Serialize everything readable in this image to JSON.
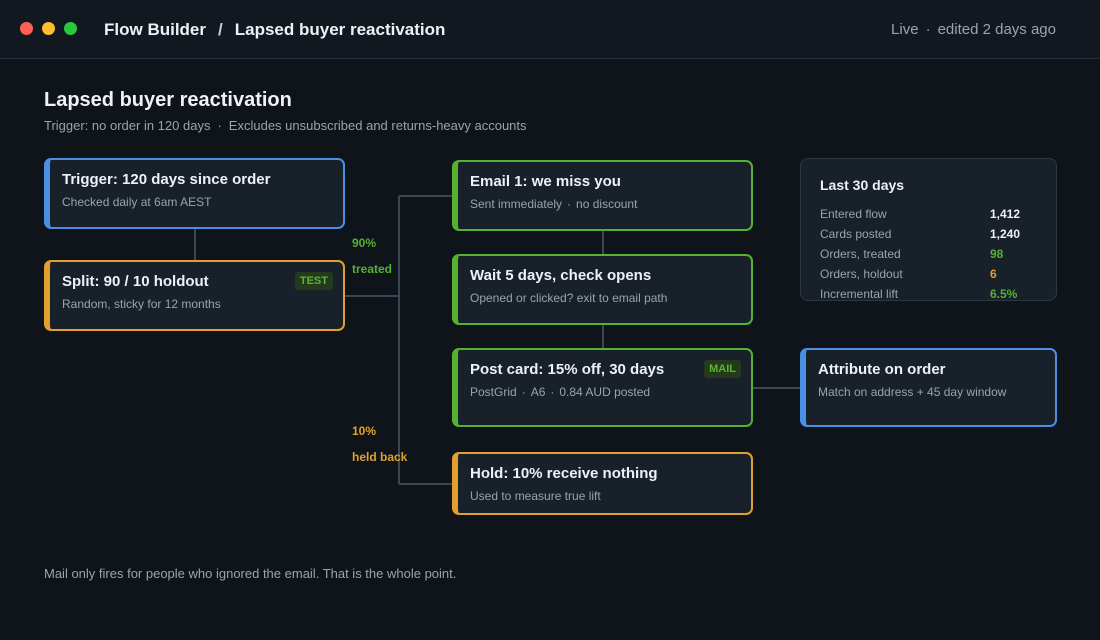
{
  "window": {
    "breadcrumb": {
      "app": "Flow Builder",
      "separator": "/",
      "flow": "Lapsed buyer reactivation"
    },
    "status": {
      "state": "Live",
      "separator": "·",
      "edited": "edited 2 days ago"
    }
  },
  "page": {
    "title": "Lapsed buyer reactivation",
    "trigger_note": "Trigger: no order in 120 days",
    "separator": "·",
    "exclusion_note": "Excludes unsubscribed and returns-heavy accounts"
  },
  "nodes": {
    "trigger": {
      "title": "Trigger: 120 days since order",
      "subtitle": "Checked daily at 6am AEST",
      "color": "#4a90e2"
    },
    "split": {
      "title": "Split: 90 / 10 holdout",
      "subtitle": "Random, sticky for 12 months",
      "badge": "TEST",
      "color": "#e0a030"
    },
    "email1": {
      "title": "Email 1: we miss you",
      "subtitle_a": "Sent immediately",
      "separator": "·",
      "subtitle_b": "no discount",
      "color": "#56b130"
    },
    "wait": {
      "title": "Wait 5 days, check opens",
      "subtitle": "Opened or clicked? exit to email path",
      "color": "#56b130"
    },
    "postcard": {
      "title": "Post card: 15% off, 30 days",
      "subtitle_a": "PostGrid",
      "separator": "·",
      "subtitle_b": "A6",
      "subtitle_c": "0.84 AUD posted",
      "badge": "MAIL",
      "color": "#56b130"
    },
    "hold": {
      "title": "Hold: 10% receive nothing",
      "subtitle": "Used to measure true lift",
      "color": "#e0a030"
    },
    "attribute": {
      "title": "Attribute on order",
      "subtitle": "Match on address + 45 day window",
      "color": "#4a90e2"
    }
  },
  "branches": {
    "treated": {
      "percent": "90%",
      "label": "treated",
      "color": "#56b130"
    },
    "holdout": {
      "percent": "10%",
      "label": "held back",
      "color": "#e0a030"
    }
  },
  "stats": {
    "title": "Last 30 days",
    "rows": [
      {
        "label": "Entered flow",
        "value": "1,412"
      },
      {
        "label": "Cards posted",
        "value": "1,240"
      },
      {
        "label": "Orders, treated",
        "value": "98"
      },
      {
        "label": "Orders, holdout",
        "value": "6"
      },
      {
        "label": "Incremental lift",
        "value": "6.5%"
      }
    ]
  },
  "footer": {
    "note": "Mail only fires for people who ignored the email. That is the whole point."
  }
}
